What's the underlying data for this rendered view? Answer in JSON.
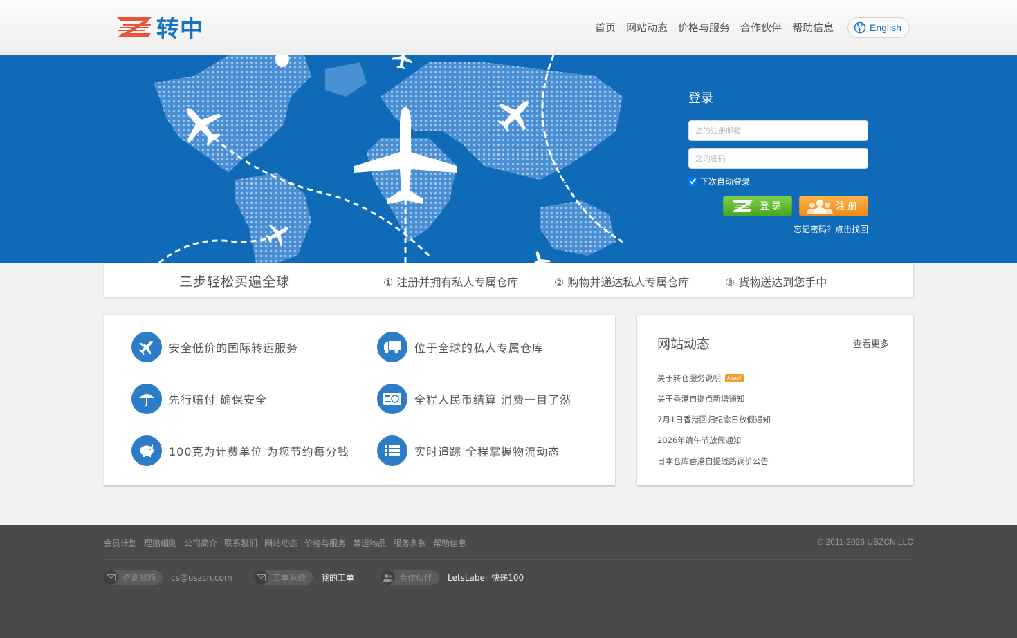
{
  "header": {
    "logo_text": "转中",
    "nav": [
      "首页",
      "网站动态",
      "价格与服务",
      "合作伙伴",
      "帮助信息"
    ],
    "lang_label": "English"
  },
  "login": {
    "title": "登录",
    "email_placeholder": "您的注册邮箱",
    "password_placeholder": "您的密码",
    "remember_label": "下次自动登录",
    "remember_checked": true,
    "login_button": "登录",
    "register_button": "注册",
    "forgot_link": "忘记密码？点击找回"
  },
  "steps": {
    "title": "三步轻松买遍全球",
    "items": [
      "① 注册并拥有私人专属仓库",
      "② 购物并递达私人专属仓库",
      "③ 货物送达到您手中"
    ]
  },
  "features": [
    {
      "icon": "airplane-icon",
      "text": "安全低价的国际转运服务"
    },
    {
      "icon": "truck-icon",
      "text": "位于全球的私人专属仓库"
    },
    {
      "icon": "umbrella-icon",
      "text": "先行赔付 确保安全"
    },
    {
      "icon": "currency-icon",
      "text": "全程人民币结算 消费一目了然"
    },
    {
      "icon": "piggy-bank-icon",
      "text": "100克为计费单位 为您节约每分钱"
    },
    {
      "icon": "list-icon",
      "text": "实时追踪 全程掌握物流动态"
    }
  ],
  "news": {
    "title": "网站动态",
    "more": "查看更多",
    "badge": "New!",
    "items": [
      "关于转仓服务说明",
      "关于香港自提点新增通知",
      "7月1日香港回归纪念日放假通知",
      "2026年端午节放假通知",
      "日本仓库香港自提线路调价公告"
    ]
  },
  "footer": {
    "links": [
      "会员计划",
      "理赔细则",
      "公司简介",
      "联系我们",
      "网站动态",
      "价格与服务",
      "禁运物品",
      "服务条款",
      "帮助信息"
    ],
    "copyright": "© 2011-2026 USZCN LLC",
    "email_label": "咨询邮箱",
    "email_value": "cs@uszcn.com",
    "ticket_label": "工单系统",
    "ticket_value": "我的工单",
    "partner_label": "合作伙伴",
    "partners": [
      "LetsLabel",
      "快递100"
    ]
  },
  "colors": {
    "brand_blue": "#1672c2",
    "hero_blue": "#0f6ab8",
    "login_green": "#4aa520",
    "register_orange": "#f08a16",
    "logo_red": "#e8533a"
  }
}
